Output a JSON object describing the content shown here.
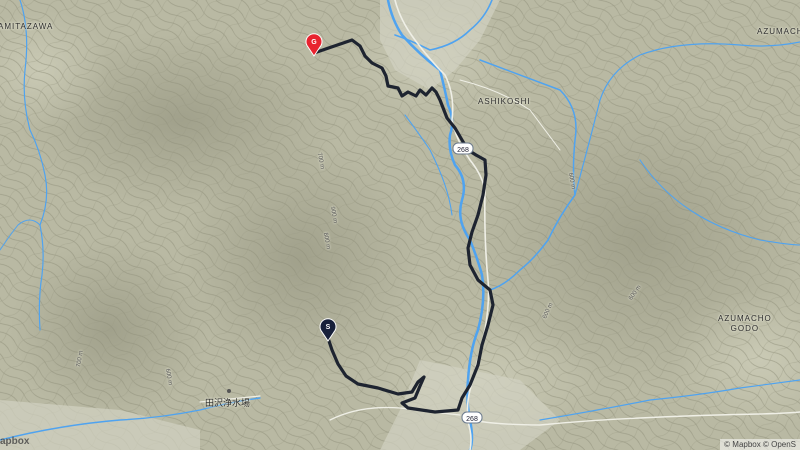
{
  "places": {
    "amitazawa": "AMITAZAWA",
    "azumacho_top": "AZUMACH",
    "ashikoshi": "ASHIKOSHI",
    "azumacho_godo_1": "AZUMACHO",
    "azumacho_godo_2": "GODO",
    "tazawa_josui": "田沢浄水場"
  },
  "contour_labels": {
    "c700_a": "700 m",
    "c900": "900 m",
    "c800": "800 m",
    "c600_a": "600 m",
    "c600_b": "600 m",
    "c600_c": "600 m",
    "c700_b": "700 m",
    "c600_d": "600 m"
  },
  "route_shields": {
    "r1": "268",
    "r2": "268"
  },
  "markers": {
    "start": "S",
    "goal": "G"
  },
  "colors": {
    "terrain": "#b9b9a3",
    "water": "#4fa3f0",
    "route": "#1e2430",
    "goal_marker": "#e8232f",
    "start_marker": "#17203a"
  },
  "attribution": "© Mapbox © OpenS",
  "logo": "apbox"
}
